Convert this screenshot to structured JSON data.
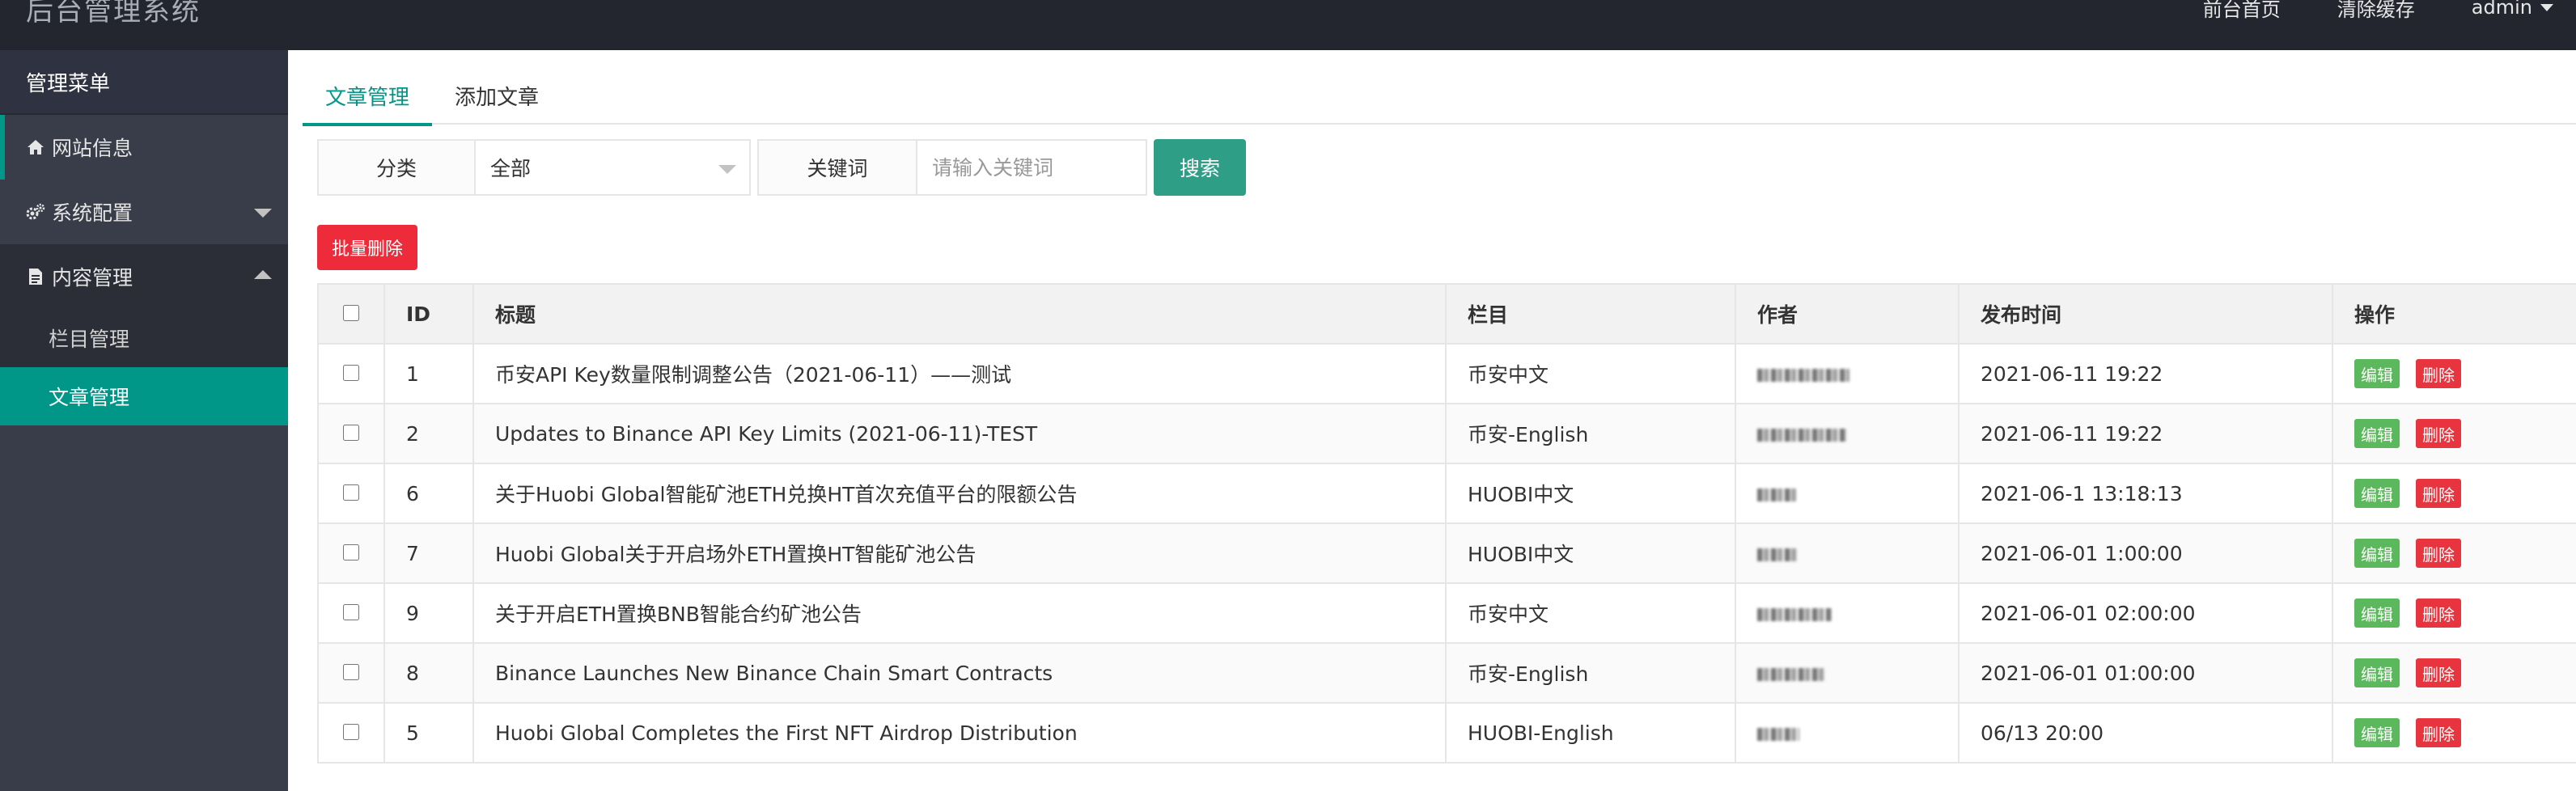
{
  "header": {
    "app_title": "后台管理系统",
    "nav": {
      "frontend_home": "前台首页",
      "clear_cache": "清除缓存",
      "user": "admin"
    }
  },
  "sidebar": {
    "title": "管理菜单",
    "items": [
      {
        "label": "网站信息",
        "icon": "home-icon"
      },
      {
        "label": "系统配置",
        "icon": "gears-icon",
        "expanded": false
      },
      {
        "label": "内容管理",
        "icon": "file-icon",
        "expanded": true,
        "children": [
          {
            "label": "栏目管理",
            "active": false
          },
          {
            "label": "文章管理",
            "active": true
          }
        ]
      }
    ]
  },
  "main": {
    "tabs": [
      {
        "label": "文章管理",
        "active": true
      },
      {
        "label": "添加文章",
        "active": false
      }
    ],
    "search": {
      "category_label": "分类",
      "category_value": "全部",
      "keyword_label": "关键词",
      "keyword_placeholder": "请输入关键词",
      "keyword_value": "",
      "search_button": "搜索"
    },
    "batch_delete_button": "批量删除",
    "table": {
      "headers": [
        "ID",
        "标题",
        "栏目",
        "作者",
        "发布时间",
        "操作"
      ],
      "edit_label": "编辑",
      "delete_label": "删除",
      "rows": [
        {
          "id": "1",
          "title": "币安API Key数量限制调整公告（2021-06-11）——测试",
          "category": "币安中文",
          "published": "2021-06-11 19:22"
        },
        {
          "id": "2",
          "title": "Updates to Binance API Key Limits (2021-06-11)-TEST",
          "category": "币安-English",
          "published": "2021-06-11 19:22"
        },
        {
          "id": "6",
          "title": "关于Huobi Global智能矿池ETH兑换HT首次充值平台的限额公告",
          "category": "HUOBI中文",
          "published": "2021-06-1 13:18:13"
        },
        {
          "id": "7",
          "title": "Huobi Global关于开启场外ETH置换HT智能矿池公告",
          "category": "HUOBI中文",
          "published": "2021-06-01 1:00:00"
        },
        {
          "id": "9",
          "title": "关于开启ETH置换BNB智能合约矿池公告",
          "category": "币安中文",
          "published": "2021-06-01 02:00:00"
        },
        {
          "id": "8",
          "title": "Binance Launches New Binance Chain Smart Contracts",
          "category": "币安-English",
          "published": "2021-06-01 01:00:00"
        },
        {
          "id": "5",
          "title": "Huobi Global Completes the First NFT Airdrop Distribution",
          "category": "HUOBI-English",
          "published": "06/13 20:00"
        }
      ]
    }
  },
  "colors": {
    "header_bg": "#23262e",
    "sidebar_bg": "#393d49",
    "accent": "#009688",
    "search_button": "#2f9e87",
    "danger": "#ee2b3a",
    "edit_button": "#5cb85c"
  }
}
